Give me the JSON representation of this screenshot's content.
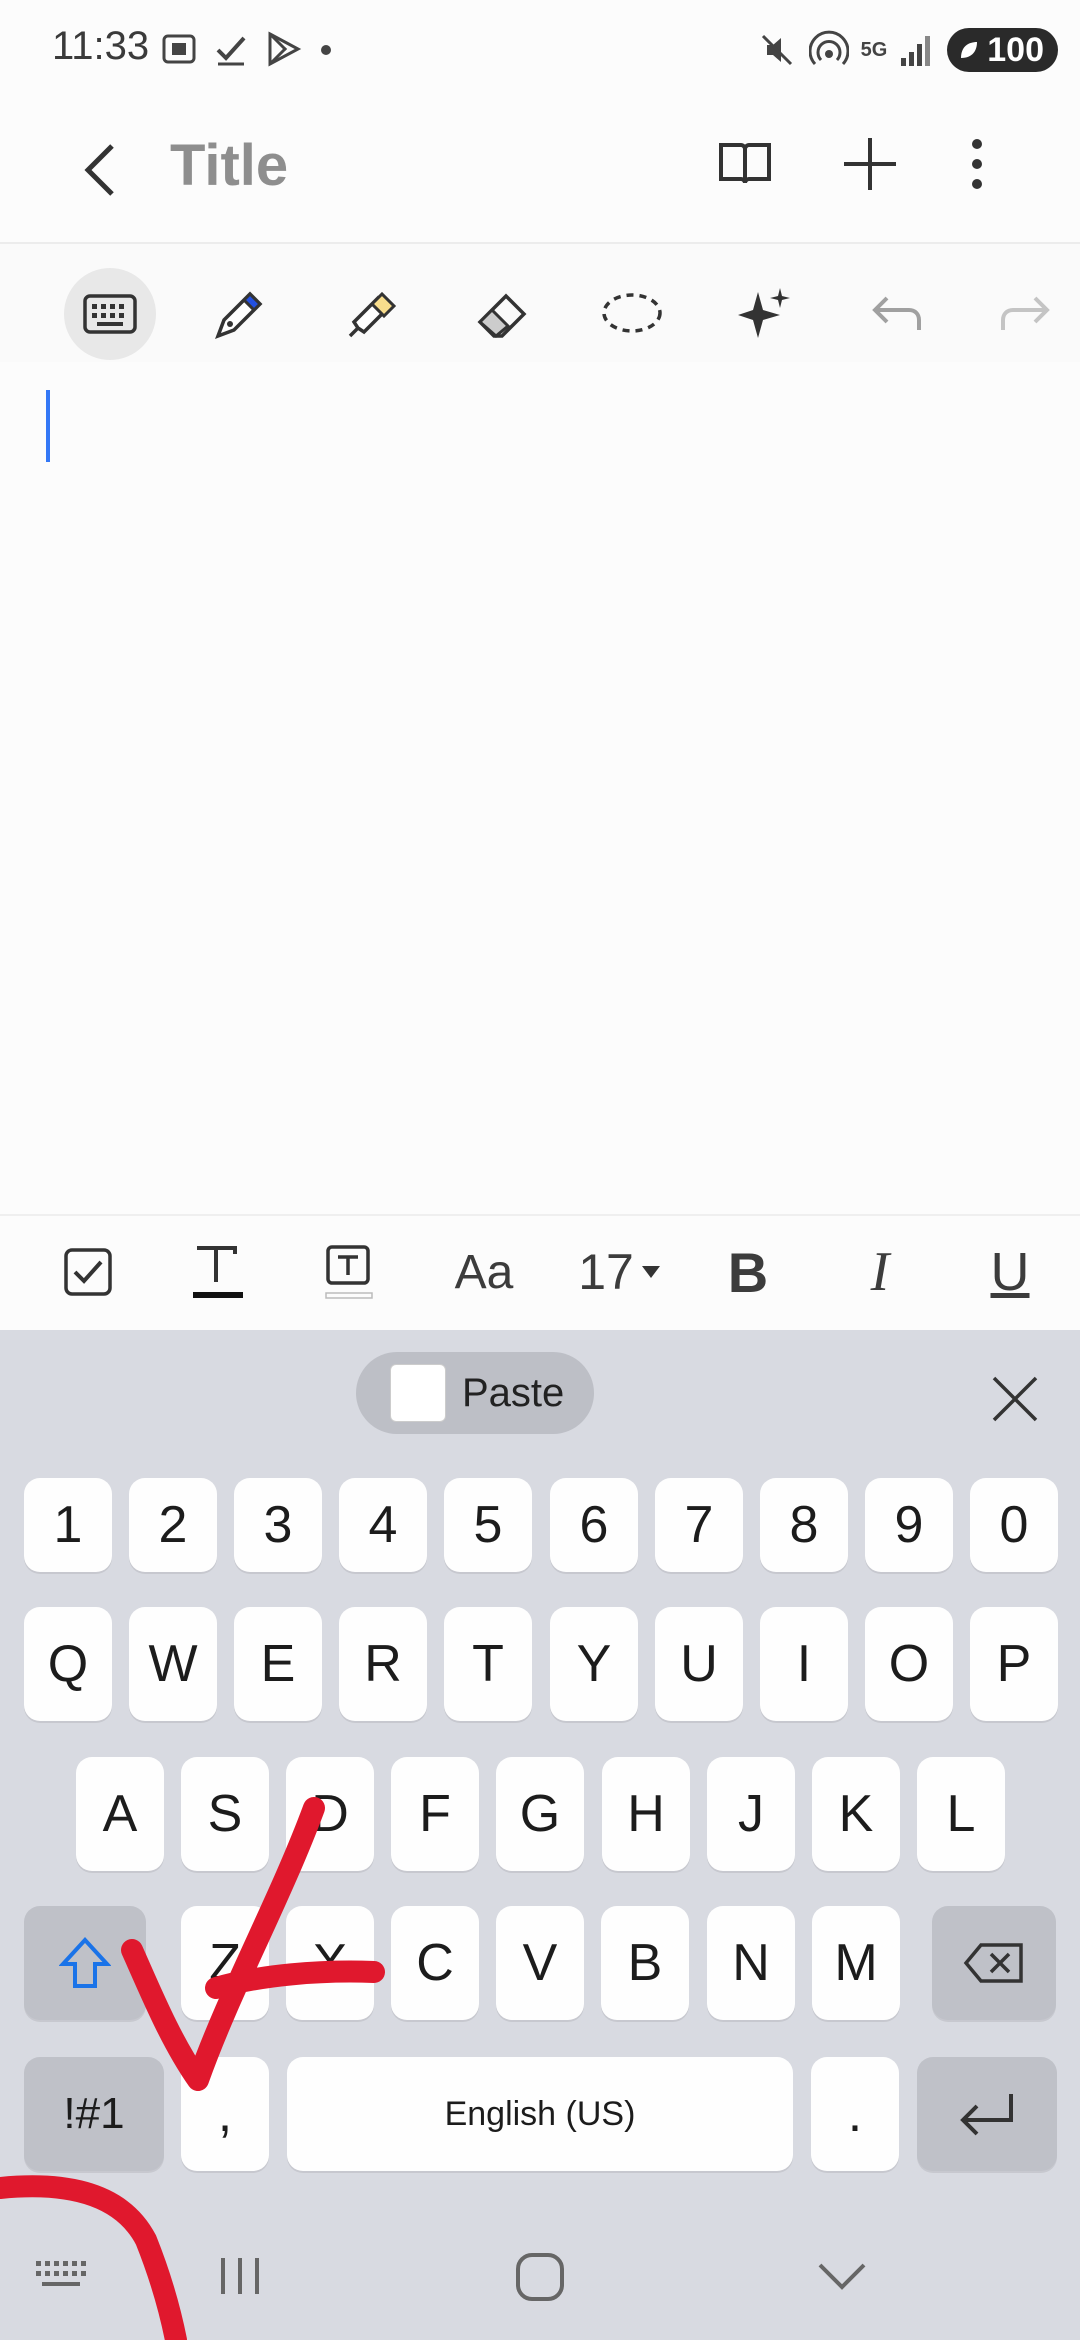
{
  "status_bar": {
    "time": "11:33",
    "network": "5G",
    "battery": "100"
  },
  "app_bar": {
    "title": "Title"
  },
  "toolbar": {
    "tools": [
      "keyboard-icon",
      "pen-icon",
      "highlighter-icon",
      "eraser-icon",
      "lasso-icon",
      "sparkle-icon",
      "undo-icon",
      "redo-icon"
    ],
    "active_tool": "keyboard-icon"
  },
  "format_bar": {
    "font_label": "Aa",
    "font_size": "17",
    "bold": "B",
    "italic": "I",
    "underline": "U"
  },
  "keyboard": {
    "paste_label": "Paste",
    "number_row": [
      "1",
      "2",
      "3",
      "4",
      "5",
      "6",
      "7",
      "8",
      "9",
      "0"
    ],
    "row1": [
      "Q",
      "W",
      "E",
      "R",
      "T",
      "Y",
      "U",
      "I",
      "O",
      "P"
    ],
    "row2": [
      "A",
      "S",
      "D",
      "F",
      "G",
      "H",
      "J",
      "K",
      "L"
    ],
    "row3": [
      "Z",
      "X",
      "C",
      "V",
      "B",
      "N",
      "M"
    ],
    "symbols_label": "!#1",
    "comma": ",",
    "space_label": "English (US)",
    "period": "."
  },
  "colors": {
    "accent": "#3478f6",
    "annotation": "#e0182d",
    "keyboard_bg": "#d8dae1"
  }
}
